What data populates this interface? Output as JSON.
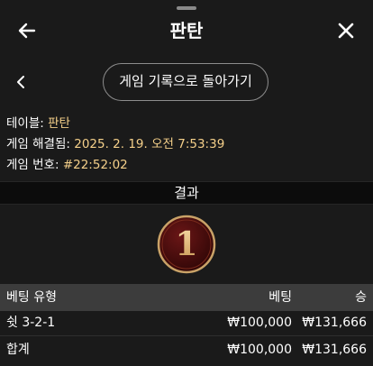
{
  "header": {
    "title": "판탄"
  },
  "subnav": {
    "history_button": "게임 기록으로 돌아가기"
  },
  "info": {
    "table_label": "테이블: ",
    "table_value": "판탄",
    "settled_label": "게임 해결됨: ",
    "settled_value": "2025. 2. 19. 오전 7:53:39",
    "game_no_label": "게임 번호: ",
    "game_no_value": "#22:52:02"
  },
  "result": {
    "heading": "결과",
    "number": "1"
  },
  "table": {
    "headers": {
      "type": "베팅 유형",
      "bet": "베팅",
      "win": "승"
    },
    "rows": [
      {
        "type": "쉿 3-2-1",
        "bet": "₩100,000",
        "win": "₩131,666"
      }
    ],
    "total": {
      "label": "합계",
      "bet": "₩100,000",
      "win": "₩131,666"
    }
  },
  "colors": {
    "background": "#1a1a1a",
    "accent_value": "#f5d08a",
    "ball_fill": "#4a0e0e",
    "ball_ring": "#c9a267"
  }
}
